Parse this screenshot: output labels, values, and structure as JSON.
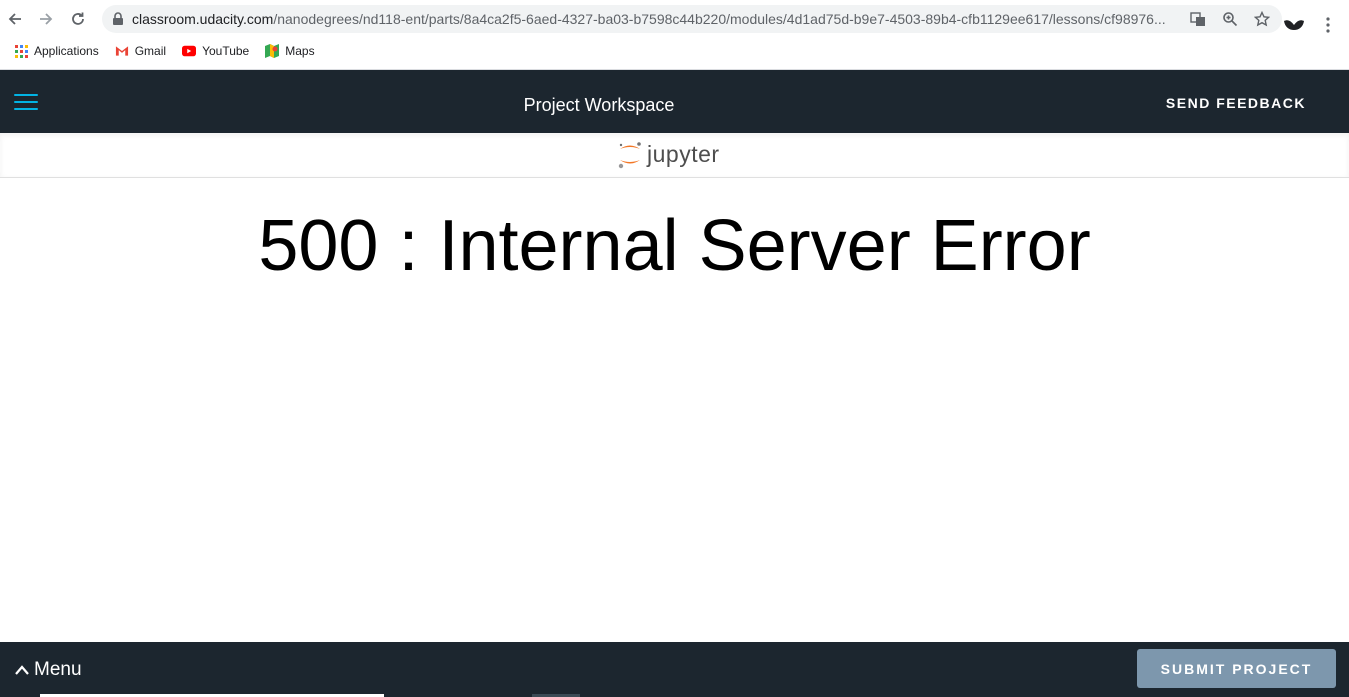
{
  "browser": {
    "url_host": "classroom.udacity.com",
    "url_path": "/nanodegrees/nd118-ent/parts/8a4ca2f5-6aed-4327-ba03-b7598c44b220/modules/4d1ad75d-b9e7-4503-89b4-cfb1129ee617/lessons/cf98976...",
    "bookmarks": [
      {
        "label": "Applications",
        "icon": "apps-grid-icon"
      },
      {
        "label": "Gmail",
        "icon": "gmail-icon"
      },
      {
        "label": "YouTube",
        "icon": "youtube-icon"
      },
      {
        "label": "Maps",
        "icon": "maps-icon"
      }
    ]
  },
  "header": {
    "title": "Project Workspace",
    "feedback_label": "SEND FEEDBACK"
  },
  "jupyter": {
    "logo_text": "jupyter"
  },
  "main": {
    "error_text": "500 : Internal Server Error"
  },
  "footer": {
    "menu_label": "Menu",
    "submit_label": "SUBMIT PROJECT"
  },
  "colors": {
    "header_bg": "#1c262f",
    "accent": "#02b3e4",
    "submit_bg": "#7d97ad",
    "jupyter_orange": "#f37726"
  }
}
